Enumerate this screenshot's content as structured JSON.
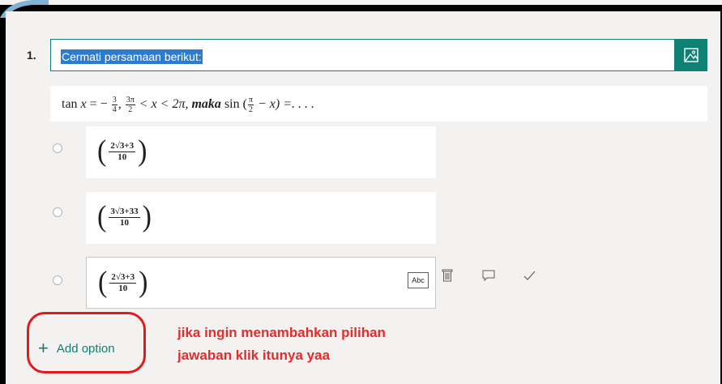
{
  "question": {
    "number": "1.",
    "title": "Cermati persamaan berikut:",
    "formula": {
      "lead": "tan",
      "var": "x",
      "eq": "= −",
      "f1_num": "3",
      "f1_den": "4",
      "f2_num": "3π",
      "f2_den": "2",
      "ineq": "< x < 2π,",
      "maka": "maka",
      "sin": "sin",
      "f3_num": "π",
      "f3_den": "2",
      "tail": "− x) =. . . ."
    },
    "options": [
      {
        "num": "2√3+3",
        "den": "10"
      },
      {
        "num": "3√3+33",
        "den": "10"
      },
      {
        "num": "2√3+3",
        "den": "10"
      }
    ],
    "abc_label": "Abc",
    "add_option_label": "Add option",
    "annotation_line1": "jika ingin menambahkan pilihan",
    "annotation_line2": "jawaban klik itunya yaa"
  },
  "colors": {
    "accent": "#0f8074",
    "highlight": "#2b7bd1",
    "annotation": "#e82a2a"
  },
  "icons": [
    "image-icon",
    "delete-icon",
    "comment-icon",
    "check-icon",
    "plus-icon"
  ]
}
